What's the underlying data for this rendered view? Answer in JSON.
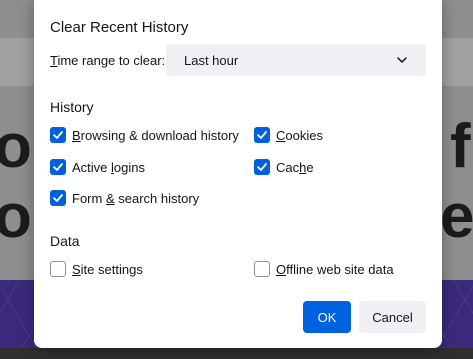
{
  "background": {
    "letters": [
      "o",
      "f",
      "o",
      "e"
    ]
  },
  "dialog": {
    "title": "Clear Recent History",
    "time_range": {
      "label_prefix": "T",
      "label_rest": "ime range to clear:",
      "selected": "Last hour"
    },
    "history_section": "History",
    "history_items": [
      {
        "key": "B",
        "rest": "rowsing & download history",
        "checked": true
      },
      {
        "key": "C",
        "rest": "ookies",
        "checked": true
      },
      {
        "key": "A",
        "pre": "Active ",
        "rest_after": "ogins",
        "checked": true
      },
      {
        "key": "C",
        "pre": "Cac",
        "rest_after": "e",
        "checked": true
      },
      {
        "key": "F",
        "rest": "orm & search history",
        "checked": true
      }
    ],
    "labels": {
      "browsing_u": "B",
      "browsing_rest": "rowsing & download history",
      "cookies_u": "C",
      "cookies_rest": "ookies",
      "logins_pre": "Active ",
      "logins_u": "l",
      "logins_rest": "ogins",
      "cache_pre": "Cac",
      "cache_u": "h",
      "cache_rest": "e",
      "form_pre": "Form ",
      "form_u": "&",
      "form_rest": " search history",
      "site_u": "S",
      "site_rest": "ite settings",
      "offline_u": "O",
      "offline_rest": "ffline web site data"
    },
    "data_section": "Data",
    "data_items": [
      {
        "label": "Site settings",
        "checked": false
      },
      {
        "label": "Offline web site data",
        "checked": false
      }
    ],
    "buttons": {
      "ok": "OK",
      "cancel": "Cancel"
    },
    "colors": {
      "accent": "#0061e0",
      "text": "#15141a",
      "button_secondary": "#f0f0f4"
    }
  }
}
